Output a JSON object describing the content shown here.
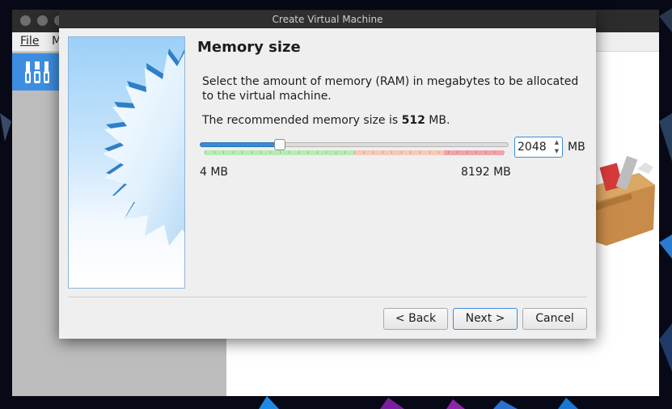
{
  "dialog": {
    "title": "Create Virtual Machine",
    "page_title": "Memory size",
    "description": "Select the amount of memory (RAM) in megabytes to be allocated to the virtual machine.",
    "recommended_prefix": "The recommended memory size is ",
    "recommended_value": "512",
    "recommended_suffix": " MB."
  },
  "memory": {
    "value": "2048",
    "unit": "MB",
    "min_label": "4 MB",
    "max_label": "8192 MB",
    "min_mb": 4,
    "max_mb": 8192,
    "current_mb": 2048,
    "green_until_mb": 4096,
    "orange_until_mb": 6553
  },
  "buttons": {
    "back": "< Back",
    "next": "Next >",
    "cancel": "Cancel"
  },
  "main_window": {
    "menu": [
      "File",
      "M"
    ]
  },
  "colors": {
    "accent": "#3a8bd6",
    "zone_green": "#b6ecb3",
    "zone_orange": "#f7c9b6",
    "zone_red": "#f2a3a9"
  },
  "icons": [
    "tools-icon",
    "wizard-star-graphic",
    "toolbox-icon",
    "spin-up-arrow-icon",
    "spin-down-arrow-icon"
  ]
}
